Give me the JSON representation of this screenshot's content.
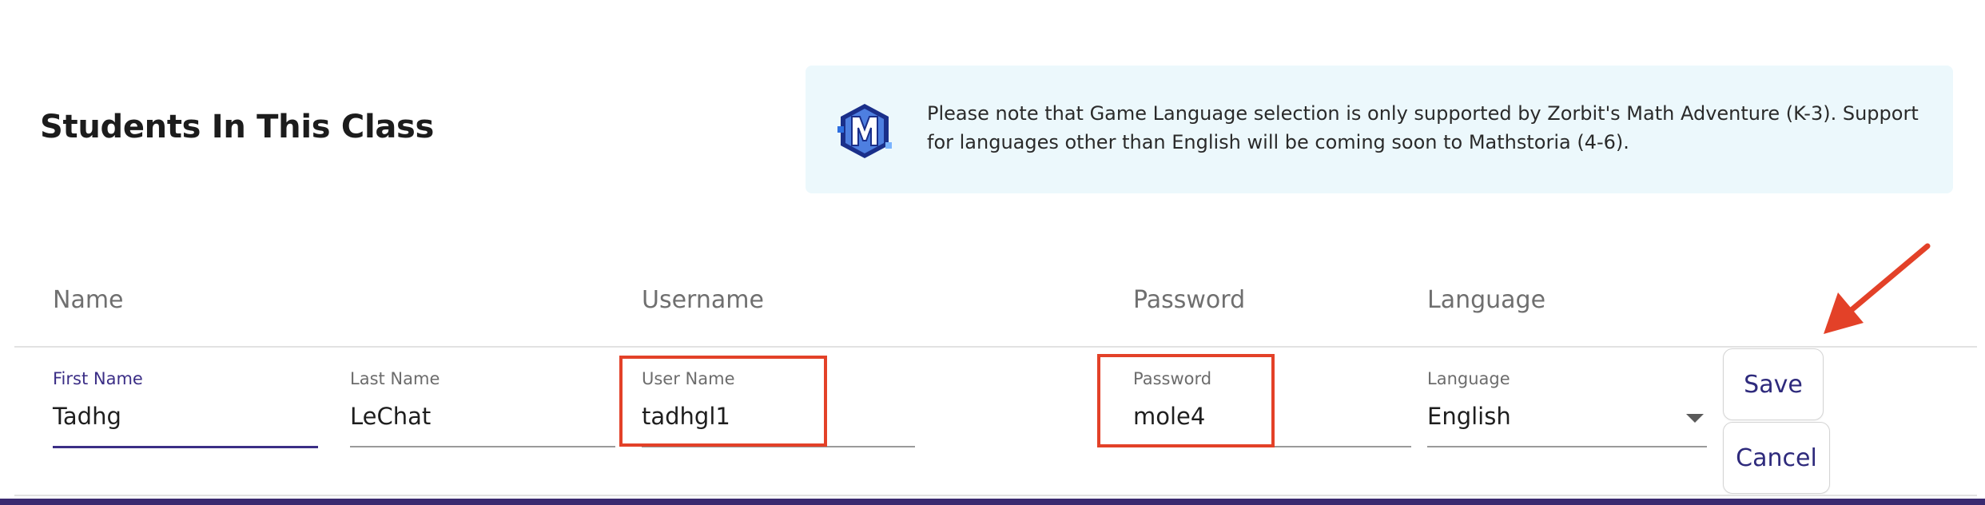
{
  "section_title": "Students In This Class",
  "notice": {
    "text": "Please note that Game Language selection is only supported by Zorbit's Math Adventure (K-3). Support for languages other than English will be coming soon to Mathstoria (4-6).",
    "logo_icon": "mathstoria-m-logo-icon"
  },
  "columns": {
    "name": "Name",
    "username": "Username",
    "password": "Password",
    "language": "Language"
  },
  "row": {
    "first_name": {
      "label": "First Name",
      "value": "Tadhg"
    },
    "last_name": {
      "label": "Last Name",
      "value": "LeChat"
    },
    "user_name": {
      "label": "User Name",
      "value": "tadhgl1"
    },
    "password": {
      "label": "Password",
      "value": "mole4"
    },
    "language": {
      "label": "Language",
      "value": "English"
    }
  },
  "buttons": {
    "save": "Save",
    "cancel": "Cancel"
  },
  "colors": {
    "accent": "#3b2e86",
    "highlight": "#e34128",
    "notice_bg": "#ecf8fc"
  }
}
